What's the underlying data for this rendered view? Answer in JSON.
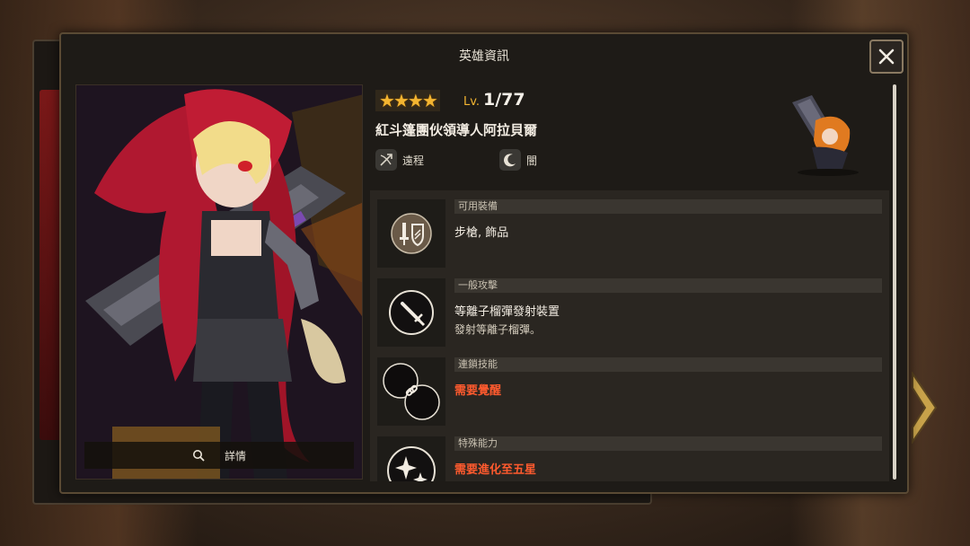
{
  "window": {
    "title": "英雄資訊",
    "close_label": "✕"
  },
  "art": {
    "details_label": "詳情"
  },
  "hero": {
    "stars": 4,
    "lv_prefix": "Lv.",
    "level": "1/77",
    "name": "紅斗篷團伙領導人阿拉貝爾",
    "attack_type": "遠程",
    "element": "闇"
  },
  "skills": [
    {
      "header": "可用裝備",
      "main": "步槍, 飾品",
      "sub": "",
      "warning": ""
    },
    {
      "header": "一般攻擊",
      "main": "等離子榴彈發射裝置",
      "sub": "發射等離子榴彈。",
      "warning": ""
    },
    {
      "header": "連鎖技能",
      "main": "",
      "sub": "",
      "warning": "需要覺醒"
    },
    {
      "header": "特殊能力",
      "main": "",
      "sub": "",
      "warning": "需要進化至五星"
    }
  ],
  "colors": {
    "star": "#f3b531",
    "warning": "#ff5a2e",
    "panel_border": "#5a4a34"
  }
}
